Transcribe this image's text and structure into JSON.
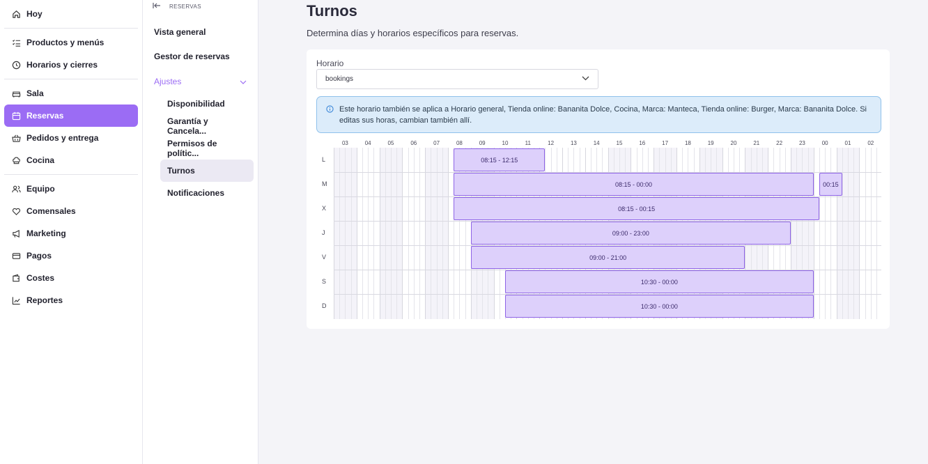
{
  "sidebar": {
    "items": [
      {
        "label": "Hoy",
        "icon": "home-icon"
      },
      {
        "label": "Productos y menús",
        "icon": "checklist-icon"
      },
      {
        "label": "Horarios y cierres",
        "icon": "clock-icon"
      },
      {
        "label": "Sala",
        "icon": "sofa-icon"
      },
      {
        "label": "Reservas",
        "icon": "calendar-icon"
      },
      {
        "label": "Pedidos y entrega",
        "icon": "basket-icon"
      },
      {
        "label": "Cocina",
        "icon": "chef-hat-icon"
      },
      {
        "label": "Equipo",
        "icon": "users-icon"
      },
      {
        "label": "Comensales",
        "icon": "heart-hand-icon"
      },
      {
        "label": "Marketing",
        "icon": "megaphone-icon"
      },
      {
        "label": "Pagos",
        "icon": "card-icon"
      },
      {
        "label": "Costes",
        "icon": "wallet-icon"
      },
      {
        "label": "Reportes",
        "icon": "chart-icon"
      }
    ],
    "active_color": "#9b6cf4"
  },
  "subnav": {
    "header": "RESERVAS",
    "items": [
      {
        "label": "Vista general"
      },
      {
        "label": "Gestor de reservas"
      },
      {
        "label": "Ajustes"
      },
      {
        "label": "Disponibilidad"
      },
      {
        "label": "Garantía y Cancela..."
      },
      {
        "label": "Permisos de polític..."
      },
      {
        "label": "Turnos"
      },
      {
        "label": "Notificaciones"
      }
    ]
  },
  "main": {
    "title": "Turnos",
    "subtitle": "Determina días y horarios específicos para reservas.",
    "schedule_label": "Horario",
    "schedule_value": "bookings",
    "info_text": "Este horario también se aplica a Horario general, Tienda online: Bananita Dolce, Cocina, Marca: Manteca, Tienda online: Burger, Marca: Bananita Dolce. Si editas sus horas, cambian también allí."
  },
  "grid": {
    "hours": [
      "03",
      "04",
      "05",
      "06",
      "07",
      "08",
      "09",
      "10",
      "11",
      "12",
      "13",
      "14",
      "15",
      "16",
      "17",
      "18",
      "19",
      "20",
      "21",
      "22",
      "23",
      "00",
      "01",
      "02"
    ],
    "days": [
      "L",
      "M",
      "X",
      "J",
      "V",
      "S",
      "D"
    ],
    "shifts": [
      {
        "day": 0,
        "label": "08:15 - 12:15",
        "start": "08:15",
        "end": "12:15"
      },
      {
        "day": 1,
        "label": "08:15 - 00:00",
        "start": "08:15",
        "end": "00:00"
      },
      {
        "day": 1,
        "label": "00:15",
        "start": "00:15",
        "end": "01:15"
      },
      {
        "day": 2,
        "label": "08:15 - 00:15",
        "start": "08:15",
        "end": "00:15"
      },
      {
        "day": 3,
        "label": "09:00 - 23:00",
        "start": "09:00",
        "end": "23:00"
      },
      {
        "day": 4,
        "label": "09:00 - 21:00",
        "start": "09:00",
        "end": "21:00"
      },
      {
        "day": 5,
        "label": "10:30 - 00:00",
        "start": "10:30",
        "end": "00:00"
      },
      {
        "day": 6,
        "label": "10:30 - 00:00",
        "start": "10:30",
        "end": "00:00"
      }
    ]
  }
}
